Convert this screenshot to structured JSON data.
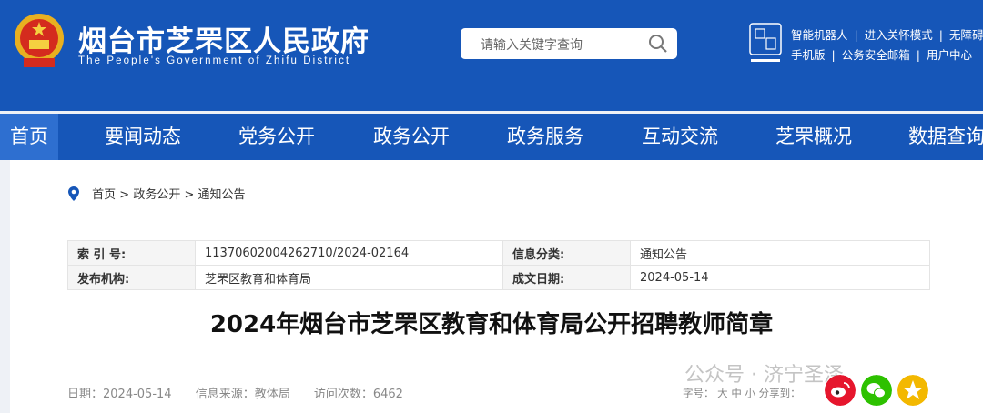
{
  "header": {
    "title": "烟台市芝罘区人民政府",
    "subtitle": "The People's Government of Zhifu District",
    "search_placeholder": "请输入关键字查询",
    "top_links_row1": [
      "智能机器人",
      "进入关怀模式",
      "无障碍"
    ],
    "top_links_row2": [
      "手机版",
      "公务安全邮箱",
      "用户中心"
    ],
    "colors": {
      "brand": "#1656b8",
      "nav_active": "#2e6fd0"
    }
  },
  "nav": {
    "items": [
      "首页",
      "要闻动态",
      "党务公开",
      "政务公开",
      "政务服务",
      "互动交流",
      "芝罘概况",
      "数据查询"
    ],
    "active": "首页"
  },
  "breadcrumb": {
    "items": [
      "首页",
      "政务公开",
      "通知公告"
    ],
    "separator": ">"
  },
  "info": {
    "index_label": "索 引 号:",
    "index_value": "11370602004262710/2024-02164",
    "category_label": "信息分类:",
    "category_value": "通知公告",
    "publisher_label": "发布机构:",
    "publisher_value": "芝罘区教育和体育局",
    "date_label": "成文日期:",
    "date_value": "2024-05-14"
  },
  "article": {
    "title": "2024年烟台市芝罘区教育和体育局公开招聘教师简章",
    "date": "日期：2024-05-14",
    "source": "信息来源：教体局",
    "visits": "访问次数：6462",
    "font_size_label": "字号：",
    "font_sizes": [
      "大",
      "中",
      "小"
    ],
    "share_label": "分享到："
  },
  "share": {
    "icons": [
      "weibo-icon",
      "wechat-icon",
      "qzone-icon"
    ],
    "colors": [
      "#e6162d",
      "#2dc100",
      "#f3b800"
    ]
  },
  "watermark": "公众号 · 济宁圣泽"
}
